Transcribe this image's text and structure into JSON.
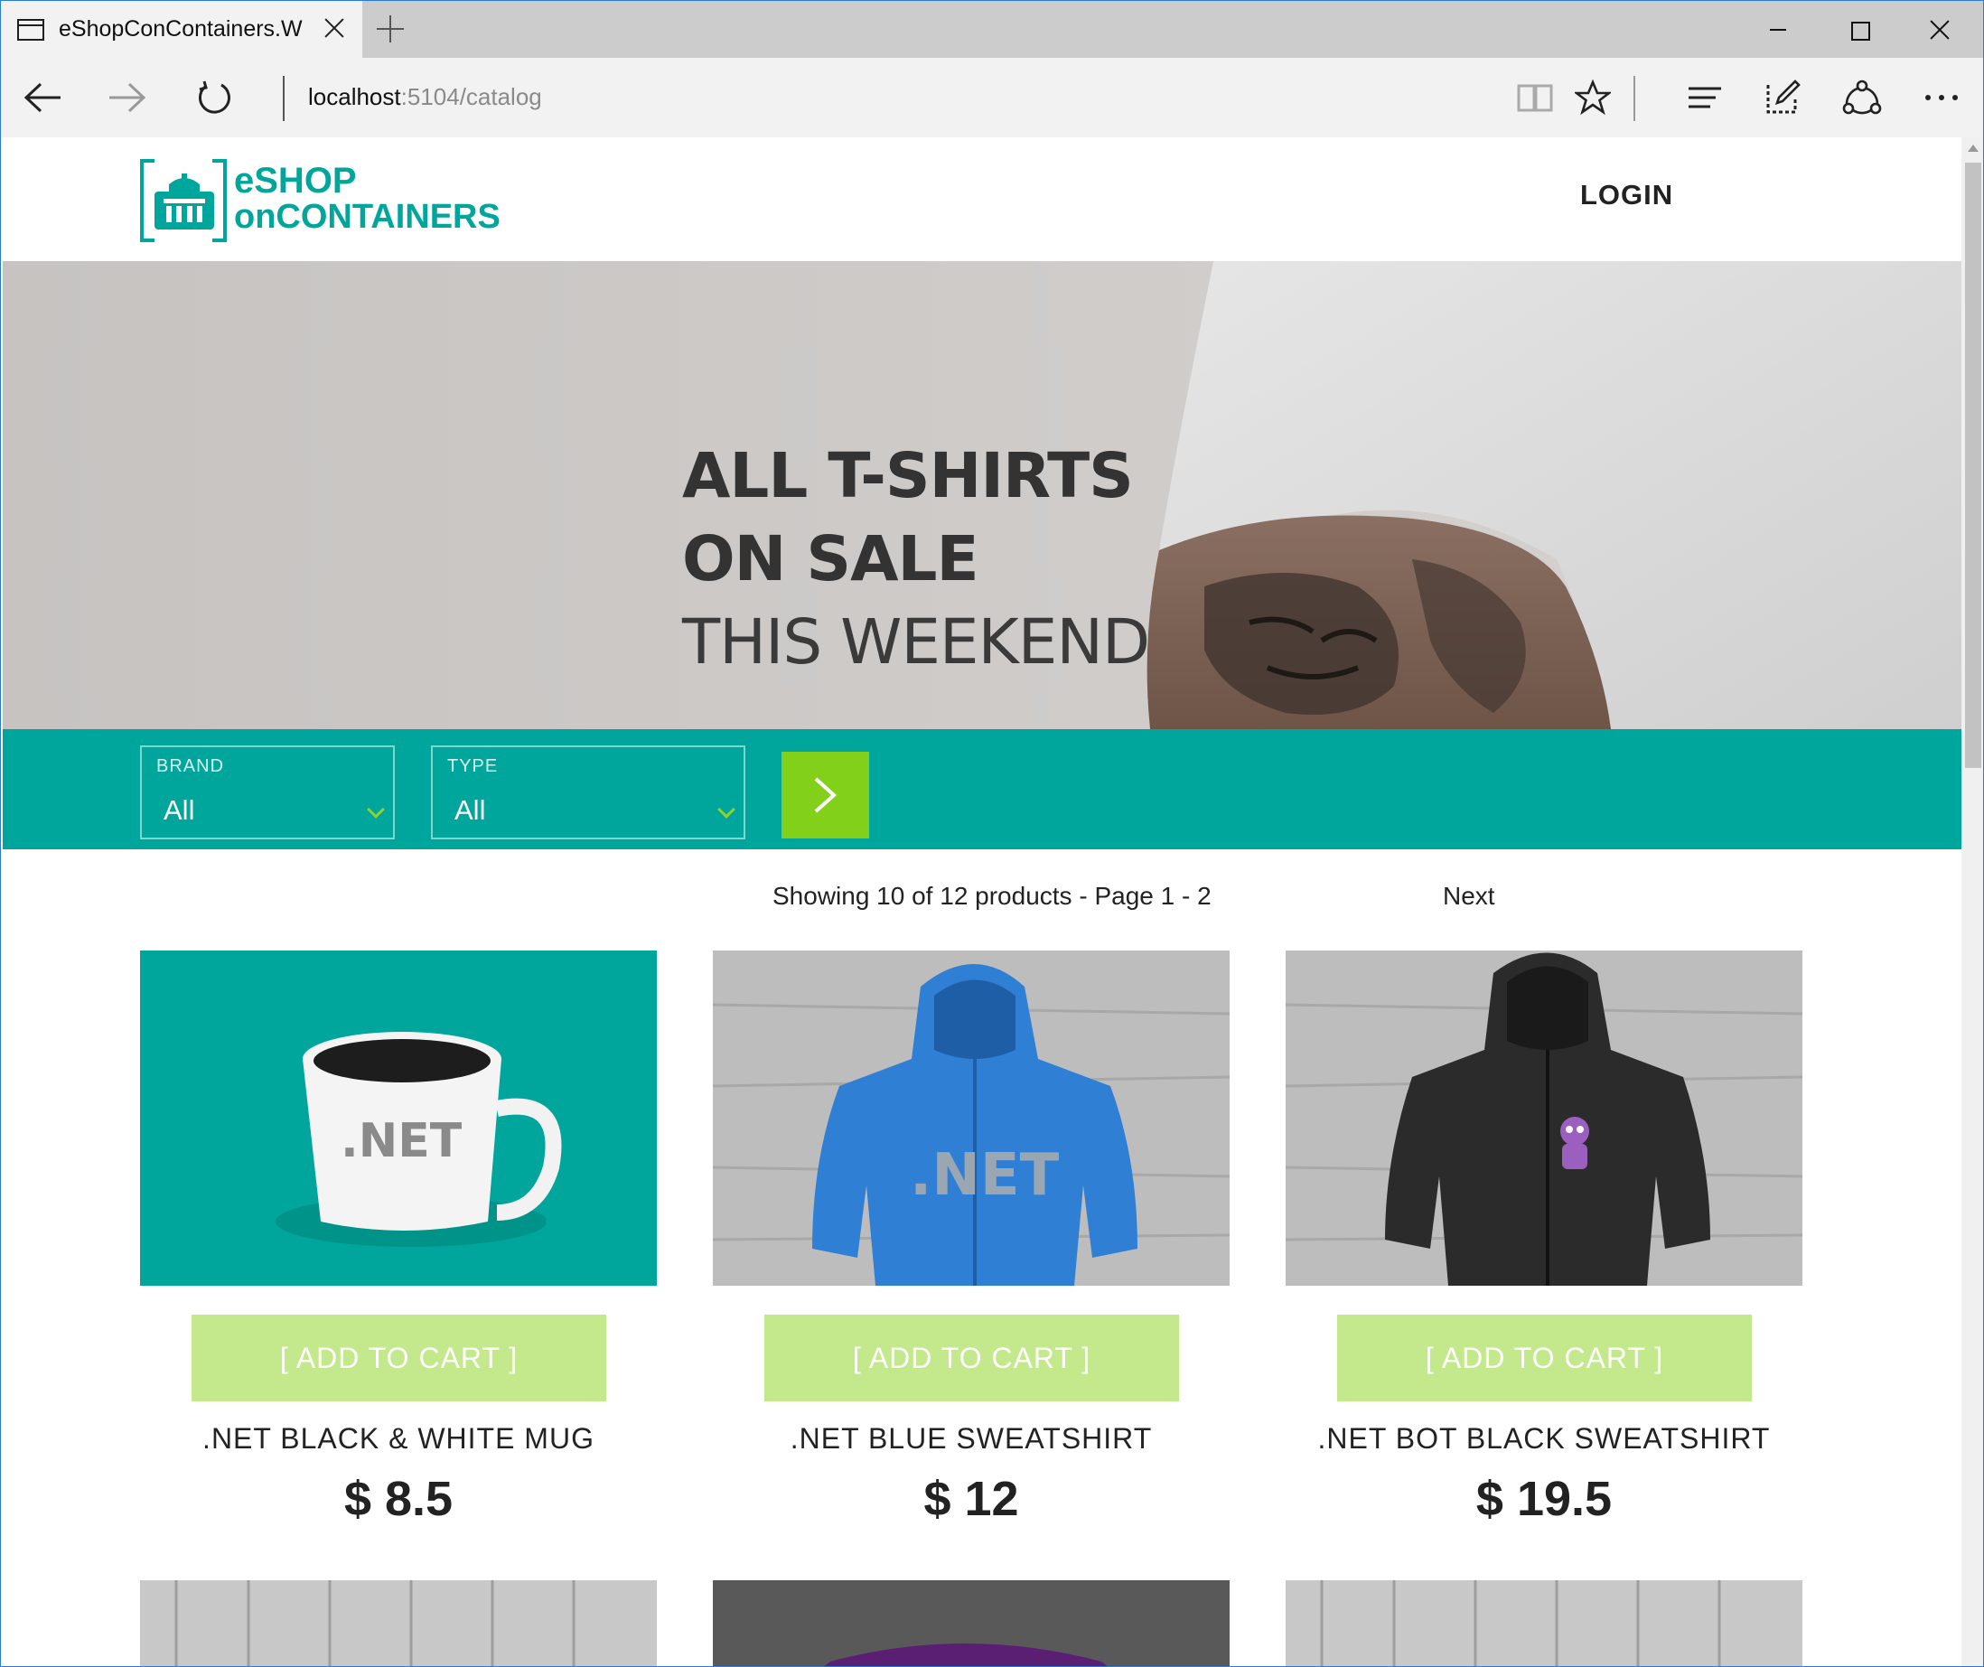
{
  "browser": {
    "tab_title": "eShopConContainers.W",
    "address_host": "localhost",
    "address_path": ":5104/catalog"
  },
  "site": {
    "logo_line1": "eSHOP",
    "logo_line2": "onCONTAINERS",
    "login_label": "LOGIN",
    "brand_color": "#00a69c",
    "accent_color": "#83d01b"
  },
  "hero": {
    "line1": "ALL T-SHIRTS",
    "line2": "ON SALE",
    "line3": "THIS WEEKEND"
  },
  "filters": {
    "brand_label": "BRAND",
    "brand_value": "All",
    "type_label": "TYPE",
    "type_value": "All"
  },
  "pager": {
    "info": "Showing 10 of 12 products - Page 1 - 2",
    "next_label": "Next"
  },
  "products": [
    {
      "name": ".NET BLACK & WHITE MUG",
      "price": "$ 8.5",
      "cta": "[ ADD TO CART ]",
      "image_icon": "mug-image",
      "print": ".NET"
    },
    {
      "name": ".NET BLUE SWEATSHIRT",
      "price": "$ 12",
      "cta": "[ ADD TO CART ]",
      "image_icon": "blue-hoodie-image",
      "print": ".NET"
    },
    {
      "name": ".NET BOT BLACK SWEATSHIRT",
      "price": "$ 19.5",
      "cta": "[ ADD TO CART ]",
      "image_icon": "black-hoodie-image"
    }
  ]
}
